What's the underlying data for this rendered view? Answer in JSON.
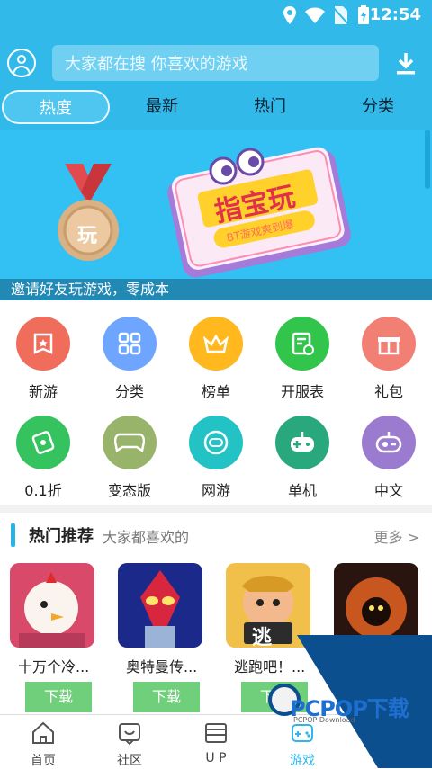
{
  "status_bar": {
    "time": "12:54"
  },
  "header": {
    "search_placeholder": "大家都在搜  你喜欢的游戏",
    "tabs": [
      {
        "label": "热度",
        "active": true
      },
      {
        "label": "最新",
        "active": false
      },
      {
        "label": "热门",
        "active": false
      },
      {
        "label": "分类",
        "active": false
      }
    ]
  },
  "banner": {
    "main_title": "指宝玩",
    "subtitle": "BT游戏爽到爆",
    "medal_text": "玩",
    "caption": "邀请好友玩游戏，零成本"
  },
  "grid": {
    "items": [
      {
        "label": "新游",
        "icon": "new-game-icon",
        "color": "#f06d5c"
      },
      {
        "label": "分类",
        "icon": "category-icon",
        "color": "#6ea6ff"
      },
      {
        "label": "榜单",
        "icon": "crown-icon",
        "color": "#ffb81d"
      },
      {
        "label": "开服表",
        "icon": "calendar-icon",
        "color": "#31c54b"
      },
      {
        "label": "礼包",
        "icon": "gift-icon",
        "color": "#f27f73"
      },
      {
        "label": "0.1折",
        "icon": "discount-icon",
        "color": "#35c35f"
      },
      {
        "label": "变态版",
        "icon": "bt-gamepad-icon",
        "color": "#98b36a"
      },
      {
        "label": "网游",
        "icon": "online-game-icon",
        "color": "#22c2c5"
      },
      {
        "label": "单机",
        "icon": "gamepad-icon",
        "color": "#29a87d"
      },
      {
        "label": "中文",
        "icon": "chinese-icon",
        "color": "#9b7bd0"
      }
    ]
  },
  "recommend": {
    "title": "热门推荐",
    "subtitle": "大家都喜欢的",
    "more": "更多 >",
    "games": [
      {
        "name": "十万个冷...",
        "button": "下载"
      },
      {
        "name": "奥特曼传...",
        "button": "下载"
      },
      {
        "name": "逃跑吧！...",
        "button": "下载",
        "thumb_text": "逃"
      },
      {
        "name": "",
        "button": ""
      }
    ]
  },
  "nav": {
    "items": [
      {
        "label": "首页"
      },
      {
        "label": "社区"
      },
      {
        "label": "U P"
      },
      {
        "label": "游戏"
      }
    ]
  },
  "watermark": {
    "brand": "PCPOP下载",
    "sub": "PCPOP Download"
  },
  "colors": {
    "primary": "#31b9ea",
    "download": "#70cf7a"
  }
}
